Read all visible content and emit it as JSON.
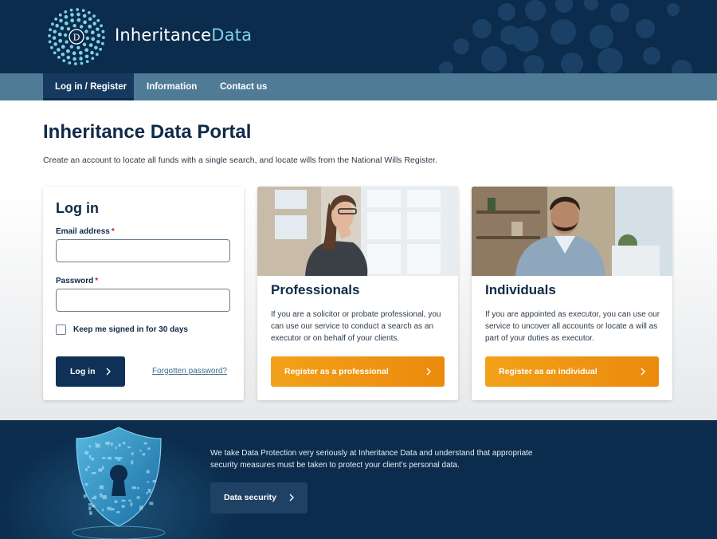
{
  "header": {
    "logo_letter": "D",
    "brand_part1": "Inheritance",
    "brand_part2": "Data"
  },
  "nav": {
    "items": [
      {
        "label": "Log in / Register",
        "active": true
      },
      {
        "label": "Information",
        "active": false
      },
      {
        "label": "Contact us",
        "active": false
      }
    ]
  },
  "main": {
    "title": "Inheritance Data Portal",
    "intro": "Create an account to locate all funds with a single search, and locate wills from the National Wills Register."
  },
  "login": {
    "title": "Log in",
    "email_label": "Email address",
    "password_label": "Password",
    "required_mark": "*",
    "email_value": "",
    "password_value": "",
    "remember_label": "Keep me signed in for 30 days",
    "remember_checked": false,
    "button_label": "Log in",
    "forgot_label": "Forgotten password?"
  },
  "professionals": {
    "title": "Professionals",
    "text": "If you are a solicitor or probate professional, you can use our service to conduct a search as an executor or on behalf of your clients.",
    "button_label": "Register as a professional"
  },
  "individuals": {
    "title": "Individuals",
    "text": "If you are appointed as executor, you can use our service to uncover all accounts or locate a will as part of your duties as executor.",
    "button_label": "Register as an individual"
  },
  "footer": {
    "text": "We take Data Protection very seriously at Inheritance Data and understand that appropriate security measures must be taken to protect your client’s personal data.",
    "button_label": "Data security"
  },
  "colors": {
    "navy": "#0b2c4c",
    "nav_bar": "#4f7b97",
    "accent_orange": "#f2a11a",
    "brand_teal": "#7fd0e6"
  },
  "icons": {
    "button_chevron": "chevron-right-icon",
    "logo": "dotted-circle-logo-icon",
    "footer_art": "shield-keyhole-icon"
  }
}
